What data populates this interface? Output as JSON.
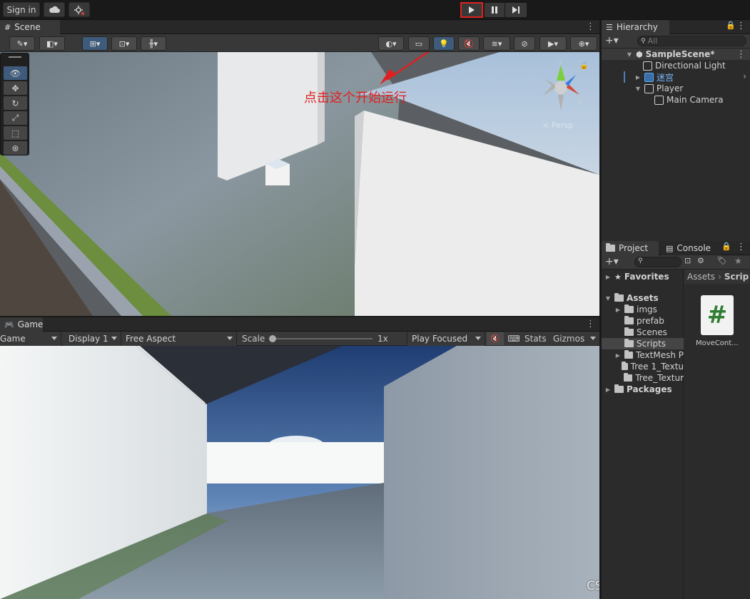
{
  "toolbar": {
    "sign_in": "Sign in",
    "play_icon": "play-icon",
    "pause_icon": "pause-icon",
    "step_icon": "step-icon"
  },
  "scene": {
    "tab_label": "Scene",
    "annotation": "点击这个开始运行",
    "persp_label": "< Persp"
  },
  "game": {
    "tab_label": "Game",
    "view_select": "Game",
    "display_select": "Display 1",
    "aspect_select": "Free Aspect",
    "scale_label": "Scale",
    "scale_value": "1x",
    "play_focused": "Play Focused",
    "stats": "Stats",
    "gizmos": "Gizmos"
  },
  "hierarchy": {
    "tab_label": "Hierarchy",
    "search_placeholder": "All",
    "items": [
      {
        "label": "SampleScene*"
      },
      {
        "label": "Directional Light"
      },
      {
        "label": "迷宫"
      },
      {
        "label": "Player"
      },
      {
        "label": "Main Camera"
      }
    ]
  },
  "project": {
    "tab_label": "Project",
    "console_tab": "Console",
    "favorites": "Favorites",
    "assets": "Assets",
    "packages": "Packages",
    "folders": [
      "imgs",
      "prefab",
      "Scenes",
      "Scripts",
      "TextMesh P",
      "Tree 1_Textu",
      "Tree_Textur"
    ],
    "breadcrumb_root": "Assets",
    "breadcrumb_current": "Scrip",
    "asset_name": "MoveCont...",
    "asset_glyph": "#"
  },
  "watermark": "CSDN @风吹落叶花飘荡",
  "colors": {
    "accent_red": "#e02020",
    "selected_blue": "#3f5b7c"
  }
}
